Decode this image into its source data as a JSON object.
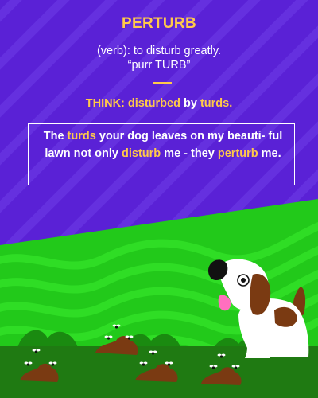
{
  "card": {
    "word": "PERTURB",
    "definition_line1": "(verb): to disturb greatly.",
    "definition_line2": "“purr TURB”",
    "think": {
      "prefix": "THINK: disturbed",
      "middle": " by ",
      "suffix": "turds."
    },
    "mnemonic": {
      "p1": "The ",
      "h1": "turds",
      "p2": " your dog leaves on my beauti- ful lawn not only ",
      "h2": "disturb",
      "p3": " me - they ",
      "h3": "perturb",
      "p4": " me."
    }
  },
  "colors": {
    "background": "#5a21d6",
    "accent": "#ffc94a",
    "grass": "#22c91a",
    "ground": "#1f7a12",
    "dirt": "#7a3a12"
  }
}
